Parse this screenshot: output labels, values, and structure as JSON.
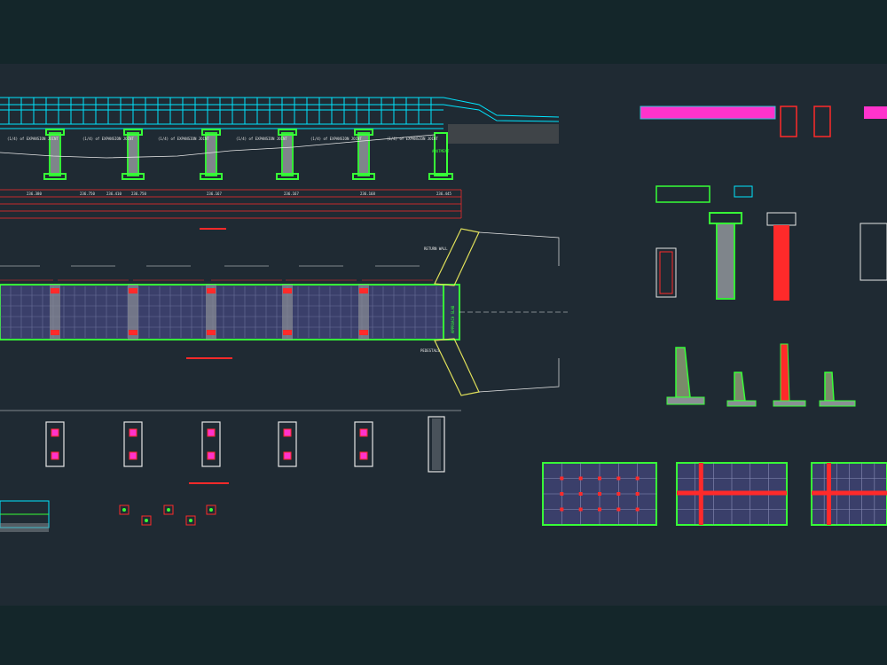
{
  "drawing": {
    "background": "#1f2a33",
    "band_color": "#14262a",
    "colors": {
      "cyan": "#00e5ff",
      "green": "#37ff37",
      "red": "#ff2a2a",
      "magenta": "#ff33cc",
      "white": "#e6e6e6",
      "gray": "#8a8f95",
      "purple": "#3a3f6a",
      "yellow": "#e0e05a"
    }
  },
  "elevation": {
    "span_notes": [
      "(1/4) of EXPANSION JOINT",
      "(1/4) of EXPANSION JOINT",
      "(1/4) of EXPANSION JOINT",
      "(1/4) of EXPANSION JOINT",
      "(1/4) of EXPANSION JOINT",
      "(1/4) of EXPANSION JOINT"
    ],
    "abutment_label": "ABUTMENT",
    "levels": [
      "236.380",
      "236.750",
      "236.410",
      "236.750",
      "236.167",
      "236.167",
      "236.168",
      "236.445"
    ]
  },
  "plan": {
    "approach_slab_label": "APPROACH SLAB",
    "pedestal_label": "PEDESTALS",
    "return_wall_label": "RETURN WALL"
  }
}
